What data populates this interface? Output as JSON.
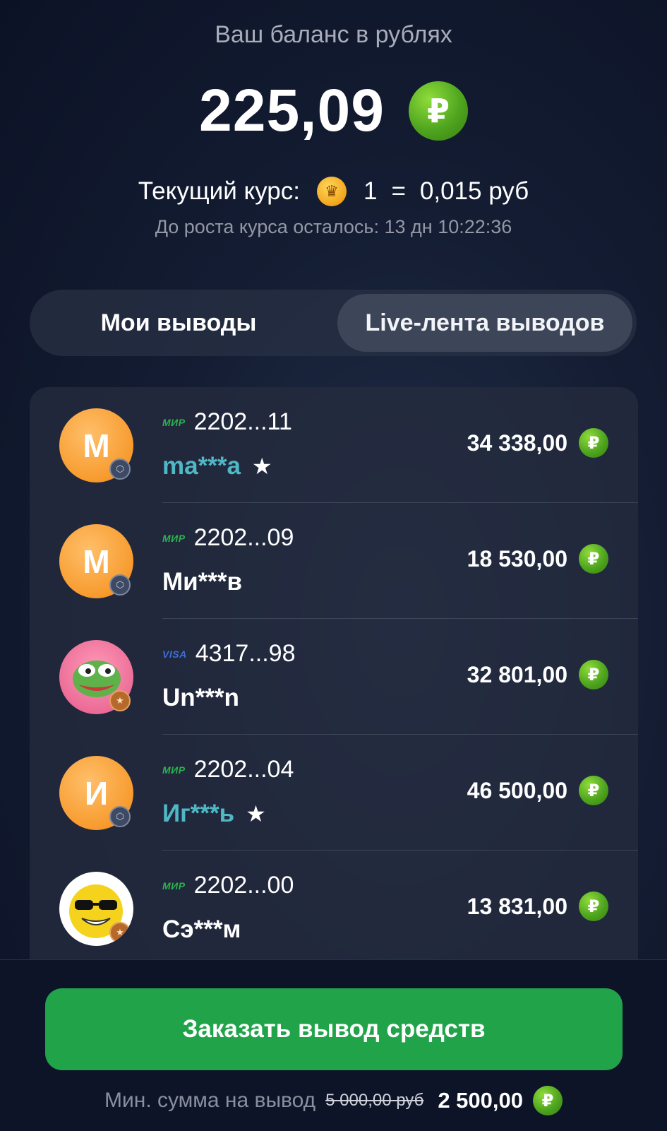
{
  "balance": {
    "caption": "Ваш баланс в рублях",
    "amount": "225,09",
    "currency_symbol": "₽"
  },
  "rate": {
    "label": "Текущий курс:",
    "coin_amount": "1",
    "equals": "=",
    "value": "0,015 руб",
    "countdown": "До роста курса осталось: 13 дн 10:22:36"
  },
  "tabs": [
    {
      "label": "Мои выводы",
      "active": false
    },
    {
      "label": "Live-лента выводов",
      "active": true
    }
  ],
  "withdrawals": [
    {
      "avatar_letter": "M",
      "payment_system": "МИР",
      "card": "2202...11",
      "user": "ma***a",
      "vip": true,
      "amount": "34 338,00"
    },
    {
      "avatar_letter": "M",
      "payment_system": "МИР",
      "card": "2202...09",
      "user": "Ми***в",
      "vip": false,
      "amount": "18 530,00"
    },
    {
      "avatar_letter": "",
      "payment_system": "VISA",
      "card": "4317...98",
      "user": "Un***n",
      "vip": false,
      "amount": "32 801,00"
    },
    {
      "avatar_letter": "И",
      "payment_system": "МИР",
      "card": "2202...04",
      "user": "Иг***ь",
      "vip": true,
      "amount": "46 500,00"
    },
    {
      "avatar_letter": "",
      "payment_system": "МИР",
      "card": "2202...00",
      "user": "Сэ***м",
      "vip": false,
      "amount": "13 831,00"
    }
  ],
  "footer": {
    "cta_label": "Заказать вывод средств",
    "min_label": "Мин. сумма на вывод",
    "min_old": "5 000,00 руб",
    "min_new": "2 500,00"
  },
  "colors": {
    "accent_green": "#21a34a",
    "rub_coin": "#4fa51f",
    "vip_name": "#4fb8c4"
  }
}
